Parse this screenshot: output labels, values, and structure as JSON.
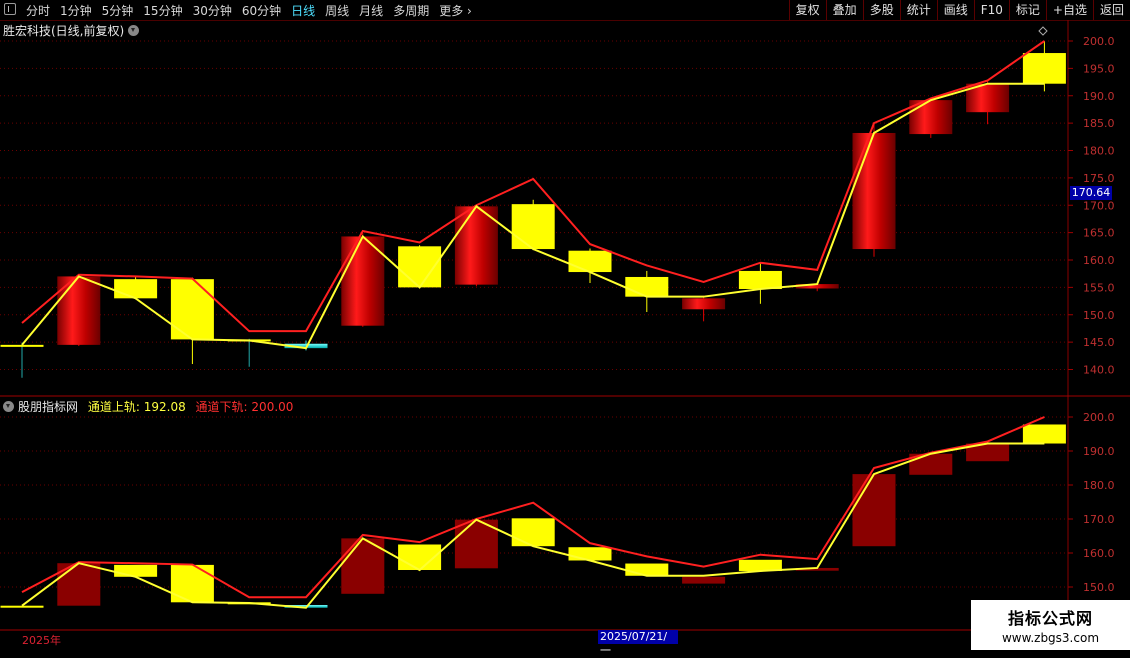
{
  "toolbar": {
    "tabs": [
      {
        "label": "分时",
        "active": false
      },
      {
        "label": "1分钟",
        "active": false
      },
      {
        "label": "5分钟",
        "active": false
      },
      {
        "label": "15分钟",
        "active": false
      },
      {
        "label": "30分钟",
        "active": false
      },
      {
        "label": "60分钟",
        "active": false
      },
      {
        "label": "日线",
        "active": true
      },
      {
        "label": "周线",
        "active": false
      },
      {
        "label": "月线",
        "active": false
      },
      {
        "label": "多周期",
        "active": false
      },
      {
        "label": "更多",
        "active": false
      }
    ],
    "right_buttons": [
      "复权",
      "叠加",
      "多股",
      "统计",
      "画线",
      "F10",
      "标记",
      "+自选",
      "返回"
    ]
  },
  "main_panel": {
    "title": "胜宏科技(日线,前复权)",
    "y_ticks": [
      "200.0",
      "195.0",
      "190.0",
      "185.0",
      "180.0",
      "175.0",
      "170.0",
      "165.0",
      "160.0",
      "155.0",
      "150.0",
      "145.0",
      "140.0"
    ],
    "current_price_label": "170.64"
  },
  "indicator_panel": {
    "name": "股朋指标网",
    "upper_label": "通道上轨:",
    "upper_value": "192.08",
    "lower_label": "通道下轨:",
    "lower_value": "200.00",
    "y_ticks": [
      "200.0",
      "190.0",
      "180.0",
      "170.0",
      "160.0",
      "150.0"
    ]
  },
  "date_axis": {
    "year_label": "2025年",
    "cursor_date": "2025/07/21/一"
  },
  "watermark": {
    "title": "指标公式网",
    "url": "www.zbgs3.com"
  },
  "colors": {
    "background": "#000000",
    "up_candle": "#e00000",
    "down_candle": "#ffff00",
    "upper_line": "#ff2020",
    "lower_line": "#ffff30",
    "grid": "#6a0000",
    "current_price_bg": "#0000a8",
    "active_tab": "#4fe0ff"
  },
  "chart_data": {
    "type": "candlestick",
    "ylim_main": [
      137,
      203
    ],
    "ylim_indicator": [
      145,
      205
    ],
    "candles": [
      {
        "open": 144.5,
        "close": 144.5,
        "high": 144.9,
        "low": 138.5,
        "dir": "flat"
      },
      {
        "open": 144.5,
        "close": 157.0,
        "high": 157.3,
        "low": 144.3,
        "dir": "up"
      },
      {
        "open": 156.5,
        "close": 153.0,
        "high": 157.0,
        "low": 152.8,
        "dir": "down"
      },
      {
        "open": 156.5,
        "close": 145.5,
        "high": 156.8,
        "low": 141.0,
        "dir": "down"
      },
      {
        "open": 145.5,
        "close": 145.3,
        "high": 145.6,
        "low": 140.5,
        "dir": "flat"
      },
      {
        "open": 144.7,
        "close": 143.9,
        "high": 145.3,
        "low": 143.5,
        "dir": "cyan"
      },
      {
        "open": 148.0,
        "close": 164.3,
        "high": 164.9,
        "low": 147.8,
        "dir": "up"
      },
      {
        "open": 162.5,
        "close": 155.0,
        "high": 162.7,
        "low": 155.0,
        "dir": "down"
      },
      {
        "open": 155.5,
        "close": 169.8,
        "high": 170.0,
        "low": 155.2,
        "dir": "up"
      },
      {
        "open": 170.2,
        "close": 162.0,
        "high": 171.0,
        "low": 161.8,
        "dir": "down"
      },
      {
        "open": 161.7,
        "close": 157.8,
        "high": 162.1,
        "low": 155.8,
        "dir": "down"
      },
      {
        "open": 156.9,
        "close": 153.3,
        "high": 158.0,
        "low": 150.5,
        "dir": "down"
      },
      {
        "open": 151.0,
        "close": 153.0,
        "high": 153.5,
        "low": 148.8,
        "dir": "up"
      },
      {
        "open": 158.0,
        "close": 154.7,
        "high": 159.5,
        "low": 152.0,
        "dir": "down"
      },
      {
        "open": 154.8,
        "close": 155.6,
        "high": 155.8,
        "low": 154.3,
        "dir": "up"
      },
      {
        "open": 162.0,
        "close": 183.2,
        "high": 184.8,
        "low": 160.6,
        "dir": "up"
      },
      {
        "open": 183.0,
        "close": 189.2,
        "high": 189.5,
        "low": 182.3,
        "dir": "up"
      },
      {
        "open": 187.0,
        "close": 192.2,
        "high": 192.8,
        "low": 184.8,
        "dir": "up"
      },
      {
        "open": 197.8,
        "close": 192.2,
        "high": 200.0,
        "low": 190.8,
        "dir": "down"
      }
    ],
    "upper_band": [
      148.5,
      157.3,
      157.0,
      156.6,
      147.0,
      147.0,
      165.3,
      163.2,
      170.0,
      174.8,
      162.9,
      159.0,
      156.0,
      159.5,
      158.2,
      185.0,
      189.5,
      192.8,
      200.0
    ],
    "lower_band": [
      144.5,
      157.0,
      153.0,
      145.5,
      145.3,
      143.9,
      164.3,
      155.0,
      169.8,
      162.0,
      157.8,
      153.3,
      153.3,
      154.7,
      155.6,
      183.2,
      189.2,
      192.2,
      192.2
    ]
  }
}
